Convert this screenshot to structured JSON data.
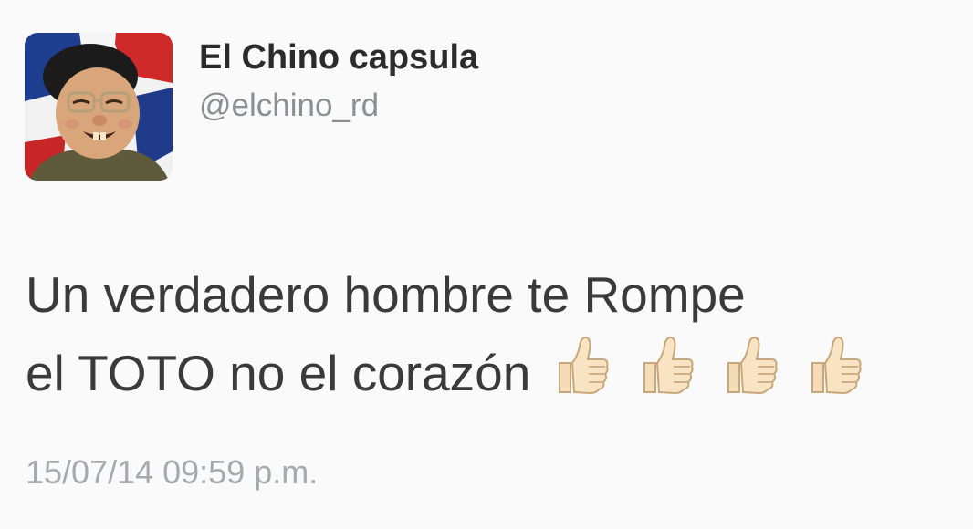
{
  "tweet": {
    "display_name": "El Chino capsula",
    "handle": "@elchino_rd",
    "text_line_1": "Un verdadero hombre te Rompe",
    "text_line_2": "el TOTO no el corazón",
    "emoji": [
      "thumbs-up",
      "thumbs-up",
      "thumbs-up",
      "thumbs-up"
    ],
    "timestamp": "15/07/14 09:59 p.m."
  },
  "colors": {
    "background": "#fafafa",
    "display_name": "#2b2b2b",
    "handle": "#8b8f94",
    "text": "#3a3a3a",
    "timestamp": "#a6a9ad"
  },
  "icons": {
    "avatar": "profile-photo-icon",
    "emoji": "thumbs-up-icon"
  }
}
